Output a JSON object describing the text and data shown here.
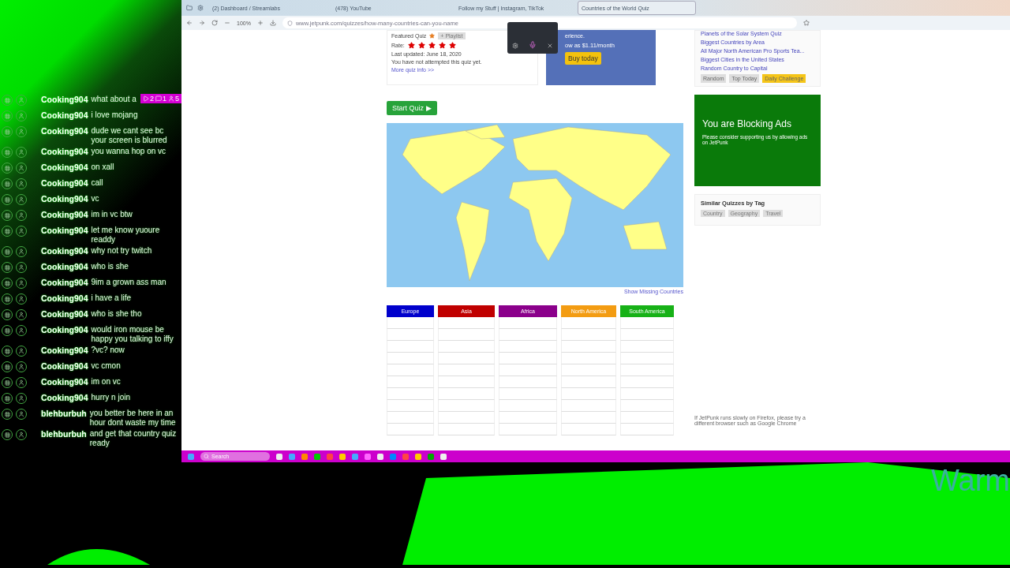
{
  "stream_badges": [
    {
      "kind": "play",
      "count": "2"
    },
    {
      "kind": "chat",
      "count": "1"
    },
    {
      "kind": "viewers",
      "count": "5"
    }
  ],
  "chat": [
    {
      "user": "Cooking904",
      "text": "what about a"
    },
    {
      "user": "Cooking904",
      "text": "i love mojang"
    },
    {
      "user": "Cooking904",
      "text": "dude we cant see bc your screen is blurred"
    },
    {
      "user": "Cooking904",
      "text": "you wanna hop on vc"
    },
    {
      "user": "Cooking904",
      "text": "on xall"
    },
    {
      "user": "Cooking904",
      "text": "call"
    },
    {
      "user": "Cooking904",
      "text": "vc"
    },
    {
      "user": "Cooking904",
      "text": "im in vc btw"
    },
    {
      "user": "Cooking904",
      "text": "let me know yuoure readdy"
    },
    {
      "user": "Cooking904",
      "text": "why not try twitch"
    },
    {
      "user": "Cooking904",
      "text": "who is she"
    },
    {
      "user": "Cooking904",
      "text": "9im a grown ass man"
    },
    {
      "user": "Cooking904",
      "text": "i have a life"
    },
    {
      "user": "Cooking904",
      "text": "who is she tho"
    },
    {
      "user": "Cooking904",
      "text": "would iron mouse be happy you talking to iffy"
    },
    {
      "user": "Cooking904",
      "text": "?vc? now"
    },
    {
      "user": "Cooking904",
      "text": "vc cmon"
    },
    {
      "user": "Cooking904",
      "text": "im on vc"
    },
    {
      "user": "Cooking904",
      "text": "hurry n join"
    },
    {
      "user": "blehburbuh",
      "text": "you better be here in an hour dont waste my time"
    },
    {
      "user": "blehburbuh",
      "text": "and get that country quiz ready"
    }
  ],
  "browser": {
    "tabs": [
      {
        "title": "(2) Dashboard / Streamlabs",
        "selected": false
      },
      {
        "title": "(478) YouTube",
        "selected": false
      },
      {
        "title": "Follow my Stuff | Instagram, TikTok",
        "selected": false
      },
      {
        "title": "Countries of the World Quiz",
        "selected": true
      }
    ],
    "zoom": "100%",
    "url": "www.jetpunk.com/quizzes/how-many-countries-can-you-name"
  },
  "quiz": {
    "featured": "Featured Quiz",
    "playlist": "+ Playlist",
    "rate_label": "Rate:",
    "stars": 5,
    "updated": "Last updated: June 18, 2020",
    "attempt": "You have not attempted this quiz yet.",
    "more_info": "More quiz info >>",
    "start": "Start Quiz ▶",
    "show_missing": "Show Missing Countries"
  },
  "ad": {
    "line_1": "erience.",
    "line_2": "ow as $1.11/month",
    "button": "Buy today"
  },
  "columns": [
    {
      "name": "Europe",
      "color": "#0000cc"
    },
    {
      "name": "Asia",
      "color": "#c00000"
    },
    {
      "name": "Africa",
      "color": "#8b008b"
    },
    {
      "name": "North America",
      "color": "#f39c12"
    },
    {
      "name": "South America",
      "color": "#17b117"
    }
  ],
  "sidebar": {
    "links": [
      "Planets of the Solar System Quiz",
      "Biggest Countries by Area",
      "All Major North American Pro Sports Tea...",
      "Biggest Cities in the United States",
      "Random Country to Capital"
    ],
    "buttons": [
      {
        "label": "Random",
        "selected": false
      },
      {
        "label": "Top Today",
        "selected": false
      },
      {
        "label": "Daily Challenge",
        "selected": true
      }
    ],
    "block_title": "You are Blocking Ads",
    "block_text": "Please consider supporting us by allowing ads on JetPunk",
    "tags_title": "Similar Quizzes by Tag",
    "tags": [
      "Country",
      "Geography",
      "Travel"
    ],
    "firefox_note": "If JetPunk runs slowly on Firefox, please try a different browser such as Google Chrome"
  },
  "taskbar": {
    "search": "Search"
  },
  "overlay_text": "Warm"
}
